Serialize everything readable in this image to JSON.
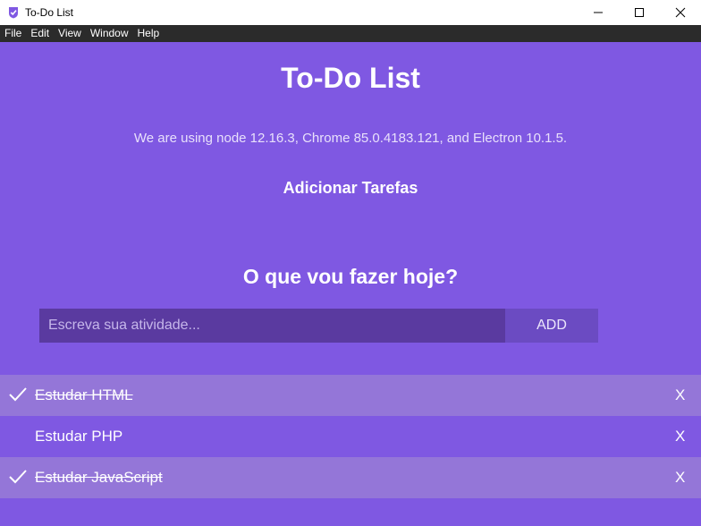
{
  "window": {
    "title": "To-Do List"
  },
  "menu": [
    "File",
    "Edit",
    "View",
    "Window",
    "Help"
  ],
  "page": {
    "title": "To-Do List",
    "versions": "We are using node 12.16.3, Chrome 85.0.4183.121, and Electron 10.1.5.",
    "subtitle": "Adicionar Tarefas",
    "question": "O que vou fazer hoje?"
  },
  "form": {
    "placeholder": "Escreva sua atividade...",
    "value": "",
    "add_label": "ADD"
  },
  "tasks": [
    {
      "label": "Estudar HTML",
      "done": true,
      "delete_label": "X"
    },
    {
      "label": "Estudar PHP",
      "done": false,
      "delete_label": "X"
    },
    {
      "label": "Estudar JavaScript",
      "done": true,
      "delete_label": "X"
    }
  ],
  "icons": {
    "app": "check-shield-icon",
    "minimize": "minimize-icon",
    "maximize": "maximize-icon",
    "close": "close-icon",
    "task_done": "checkmark-icon"
  },
  "colors": {
    "background": "#7f58e2",
    "input_background": "#5a3aa0",
    "add_button": "#6b4bc2",
    "done_row": "#9476d8",
    "menubar": "#2b2b2b"
  }
}
